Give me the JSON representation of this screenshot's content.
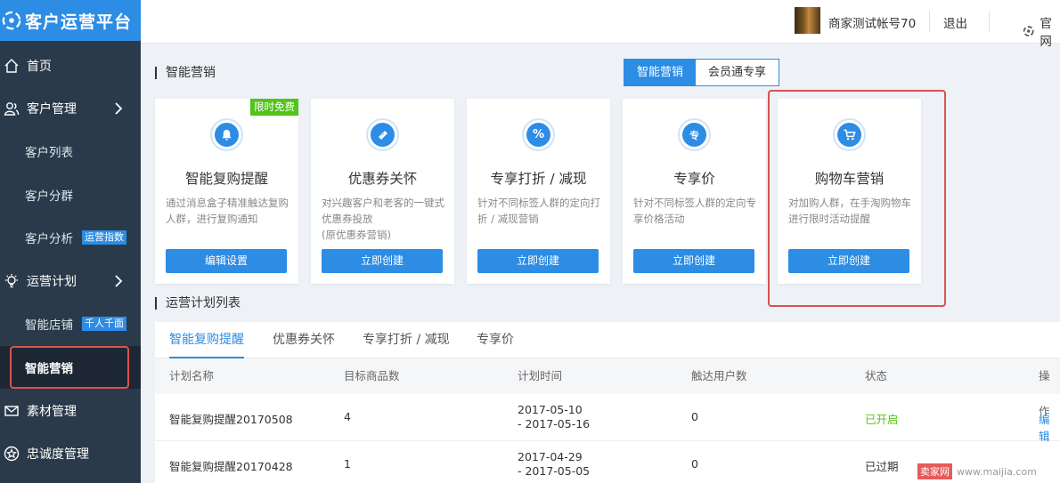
{
  "app": {
    "title": "客户运营平台"
  },
  "header": {
    "account": "商家测试帐号70",
    "logout": "退出",
    "official": "官网"
  },
  "sidebar": {
    "home": "首页",
    "customer_mgmt": "客户管理",
    "customer_list": "客户列表",
    "customer_group": "客户分群",
    "customer_analysis": "客户分析",
    "customer_analysis_badge": "运营指数",
    "ops_plan": "运营计划",
    "smart_store": "智能店铺",
    "smart_store_badge": "千人千面",
    "smart_marketing": "智能营销",
    "material_mgmt": "素材管理",
    "loyalty_mgmt": "忠诚度管理"
  },
  "main": {
    "section_title": "智能营销",
    "toggle": [
      "智能营销",
      "会员通专享"
    ],
    "cards": [
      {
        "title": "智能复购提醒",
        "desc": "通过消息盒子精准触达复购人群，进行复购通知",
        "button": "编辑设置",
        "badge": "限时免费",
        "icon": "bell-icon"
      },
      {
        "title": "优惠券关怀",
        "desc": "对兴趣客户和老客的一键式优惠券投放\n(原优惠券营销)",
        "button": "立即创建",
        "icon": "ticket-icon"
      },
      {
        "title": "专享打折 / 减现",
        "desc": "针对不同标签人群的定向打折 / 减现营销",
        "button": "立即创建",
        "icon": "percent-icon",
        "icon_text": "%"
      },
      {
        "title": "专享价",
        "desc": "针对不同标签人群的定向专享价格活动",
        "button": "立即创建",
        "icon": "exclusive-icon",
        "icon_text": "专"
      },
      {
        "title": "购物车营销",
        "desc": "对加购人群，在手淘购物车进行限时活动提醒",
        "button": "立即创建",
        "icon": "cart-icon"
      }
    ],
    "list_title": "运营计划列表",
    "tabs": [
      "智能复购提醒",
      "优惠券关怀",
      "专享打折 / 减现",
      "专享价"
    ],
    "columns": [
      "计划名称",
      "目标商品数",
      "计划时间",
      "触达用户数",
      "状态",
      "操作"
    ],
    "rows": [
      {
        "name": "智能复购提醒20170508",
        "goods": "4",
        "time1": "2017-05-10",
        "time2": "- 2017-05-16",
        "users": "0",
        "status": "已开启",
        "action": "编辑"
      },
      {
        "name": "智能复购提醒20170428",
        "goods": "1",
        "time1": "2017-04-29",
        "time2": "- 2017-05-05",
        "users": "0",
        "status": "已过期",
        "action": ""
      }
    ]
  },
  "watermark": {
    "logo": "卖家网",
    "url": "www.maijia.com"
  },
  "colors": {
    "primary": "#2d8ce4",
    "sidebar": "#2b3a4a",
    "success": "#52c41a",
    "highlight": "#d9534f"
  }
}
